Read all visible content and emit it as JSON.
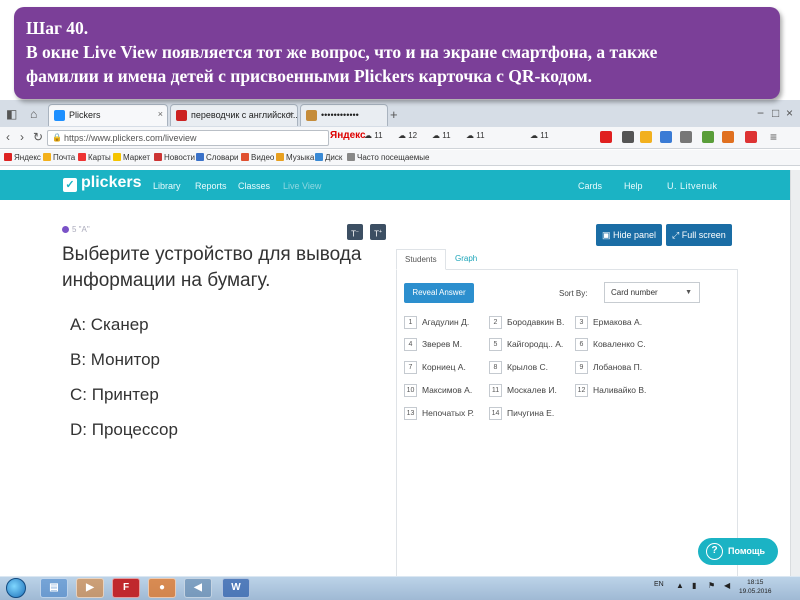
{
  "caption": {
    "line1": "Шаг 40.",
    "line2": "В окне Live View появляется тот же вопрос, что и на экране смартфона, а также",
    "line3": "фамилии и имена детей с присвоенными Plickers карточка с QR-кодом."
  },
  "browser": {
    "tabs": [
      {
        "label": "Plickers",
        "icon_color": "#1e90ff"
      },
      {
        "label": "переводчик с английског...",
        "icon_color": "#cc2222"
      },
      {
        "label": "••••••••••••",
        "icon_color": "#c58c3a"
      }
    ],
    "new_tab": "+",
    "url": "https://www.plickers.com/liveview",
    "search_engine": "Яндекс",
    "weather": [
      "11",
      "12",
      "11",
      "11",
      "11"
    ],
    "bookmarks": [
      "Яндекс",
      "Почта",
      "Карты",
      "Маркет",
      "Новости",
      "Словари",
      "Видео",
      "Музыка",
      "Диск",
      "Часто посещаемые"
    ]
  },
  "app": {
    "logo": "plickers",
    "nav": [
      "Library",
      "Reports",
      "Classes",
      "Live View"
    ],
    "right_nav": [
      "Cards",
      "Help"
    ],
    "user": "U. Litvenuk"
  },
  "question": {
    "meta": "5 \"А\"",
    "text": "Выберите устройство для вывода информации на бумагу.",
    "answers": [
      "A: Сканер",
      "B: Монитор",
      "C: Принтер",
      "D: Процессор"
    ]
  },
  "toolbar": {
    "font_smaller": "T",
    "font_larger": "T",
    "hide_panel": "Hide panel",
    "full_screen": "Full screen"
  },
  "panel": {
    "tabs": [
      "Students",
      "Graph"
    ],
    "reveal_label": "Reveal Answer",
    "sort_label": "Sort By:",
    "sort_value": "Card number",
    "students": [
      {
        "num": "1",
        "name": "Агадулин Д."
      },
      {
        "num": "2",
        "name": "Бородавкин В."
      },
      {
        "num": "3",
        "name": "Ермакова А."
      },
      {
        "num": "4",
        "name": "Зверев М."
      },
      {
        "num": "5",
        "name": "Кайгородц.. А."
      },
      {
        "num": "6",
        "name": "Коваленко С."
      },
      {
        "num": "7",
        "name": "Корниец А."
      },
      {
        "num": "8",
        "name": "Крылов С."
      },
      {
        "num": "9",
        "name": "Лобанова П."
      },
      {
        "num": "10",
        "name": "Максимов А."
      },
      {
        "num": "11",
        "name": "Москалев И."
      },
      {
        "num": "12",
        "name": "Наливайко В."
      },
      {
        "num": "13",
        "name": "Непочатых Р."
      },
      {
        "num": "14",
        "name": "Пичугина Е."
      }
    ]
  },
  "help_button": "Помощь",
  "taskbar": {
    "lang": "EN",
    "time": "18:15",
    "date": "19.05.2016"
  },
  "colors": {
    "caption_bg": "#7b3f98",
    "header_bg": "#1bb3c4",
    "primary_button": "#2c8fce"
  }
}
